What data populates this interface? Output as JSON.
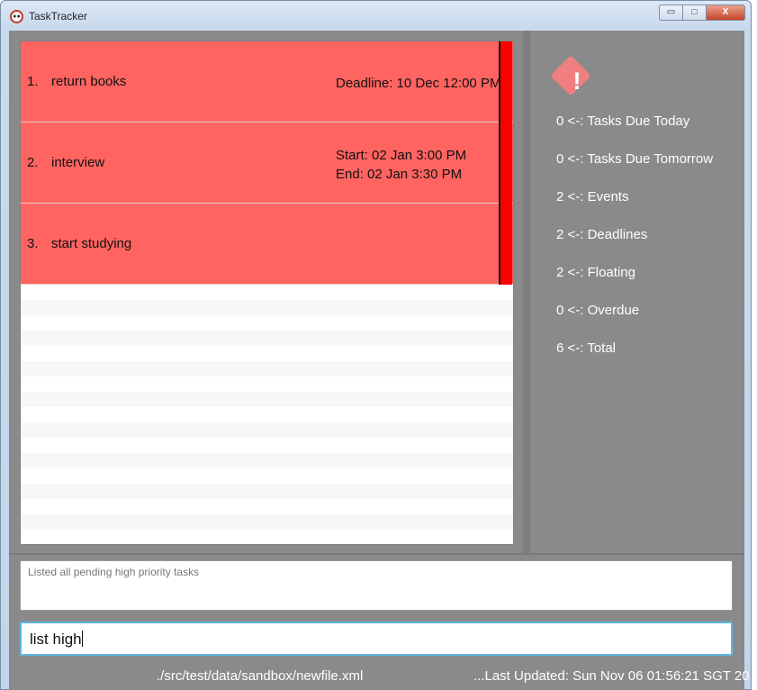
{
  "window": {
    "title": "TaskTracker",
    "minimize": "▭",
    "maximize": "□",
    "close": "X"
  },
  "tasks": [
    {
      "index": "1.",
      "name": "return books",
      "lines": [
        "Deadline: 10 Dec 12:00 PM"
      ]
    },
    {
      "index": "2.",
      "name": "interview",
      "lines": [
        "Start: 02 Jan 3:00 PM",
        "End: 02 Jan 3:30 PM"
      ]
    },
    {
      "index": "3.",
      "name": "start studying",
      "lines": []
    }
  ],
  "summary": {
    "icon": "warning-diamond-icon",
    "stats": [
      "0 <-: Tasks Due Today",
      "0 <-: Tasks Due Tomorrow",
      "2 <-: Events",
      "2 <-: Deadlines",
      "2 <-: Floating",
      "0 <-: Overdue",
      "6 <-: Total"
    ]
  },
  "result": {
    "text": "Listed all pending high priority tasks"
  },
  "command": {
    "value": "list high"
  },
  "status": {
    "file_path": "./src/test/data/sandbox/newfile.xml",
    "last_updated": "...Last Updated: Sun Nov 06 01:56:21 SGT 20"
  },
  "colors": {
    "task_card": "#ff6461",
    "priority_flag": "#ff0000",
    "panel_bg": "#8a8a8a",
    "command_border": "#5fb7e5"
  }
}
